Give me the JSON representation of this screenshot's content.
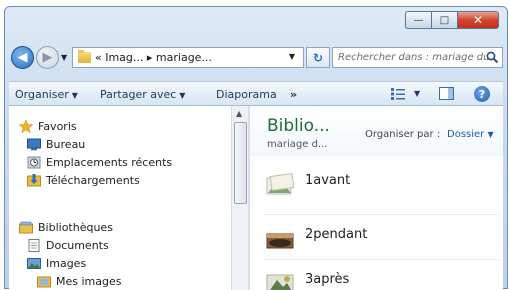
{
  "window": {
    "caption": {
      "minimize": "—",
      "maximize": "□",
      "close": "✕"
    }
  },
  "address": {
    "back_glyph": "◀",
    "forward_glyph": "▶",
    "path": "« Imag... ▸ mariage...",
    "refresh_glyph": "↻",
    "search_placeholder": "Rechercher dans : mariage du..."
  },
  "toolbar": {
    "organize": "Organiser",
    "share": "Partager avec",
    "slideshow": "Diaporama",
    "more": "»",
    "help": "?"
  },
  "nav": {
    "favorites": {
      "label": "Favoris",
      "items": [
        {
          "label": "Bureau",
          "icon": "desktop-icon"
        },
        {
          "label": "Emplacements récents",
          "icon": "recent-places-icon"
        },
        {
          "label": "Téléchargements",
          "icon": "downloads-folder-icon"
        }
      ]
    },
    "libraries": {
      "label": "Bibliothèques",
      "items": [
        {
          "label": "Documents",
          "icon": "documents-icon"
        },
        {
          "label": "Images",
          "icon": "pictures-icon"
        },
        {
          "label": "Mes images",
          "icon": "my-pictures-folder-icon"
        }
      ]
    }
  },
  "content": {
    "library_title": "Biblio...",
    "library_subtitle": "mariage d...",
    "arrange_by_label": "Organiser par :",
    "arrange_by_value": "Dossier",
    "folders": [
      {
        "name": "1avant"
      },
      {
        "name": "2pendant"
      },
      {
        "name": "3après"
      }
    ]
  },
  "colors": {
    "library_title": "#1e6e3d",
    "accent_link": "#1e5fae",
    "close_button": "#c9391f"
  }
}
